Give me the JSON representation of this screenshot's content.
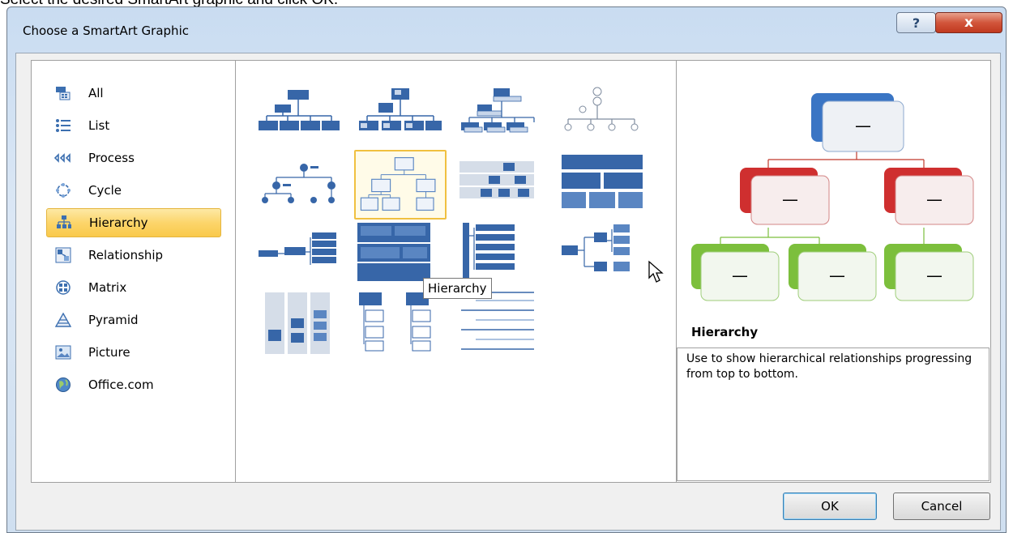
{
  "instruction": "Select the desired SmartArt graphic and click OK.",
  "dialog": {
    "title": "Choose a SmartArt Graphic",
    "help_label": "?",
    "close_label": "x"
  },
  "categories": [
    {
      "label": "All",
      "icon": "all-icon"
    },
    {
      "label": "List",
      "icon": "list-icon"
    },
    {
      "label": "Process",
      "icon": "process-icon"
    },
    {
      "label": "Cycle",
      "icon": "cycle-icon"
    },
    {
      "label": "Hierarchy",
      "icon": "hierarchy-icon",
      "selected": true
    },
    {
      "label": "Relationship",
      "icon": "relationship-icon"
    },
    {
      "label": "Matrix",
      "icon": "matrix-icon"
    },
    {
      "label": "Pyramid",
      "icon": "pyramid-icon"
    },
    {
      "label": "Picture",
      "icon": "picture-icon"
    },
    {
      "label": "Office.com",
      "icon": "globe-icon"
    }
  ],
  "gallery": {
    "selected_index": 5,
    "tooltip": "Hierarchy"
  },
  "preview": {
    "title": "Hierarchy",
    "description": "Use to show hierarchical relationships progressing from top to bottom.",
    "node_text": "—"
  },
  "buttons": {
    "ok": "OK",
    "cancel": "Cancel"
  },
  "colors": {
    "blue": "#2f5f9e",
    "red": "#c0392b",
    "green": "#7cbf3c",
    "selection": "#f9c94b"
  }
}
